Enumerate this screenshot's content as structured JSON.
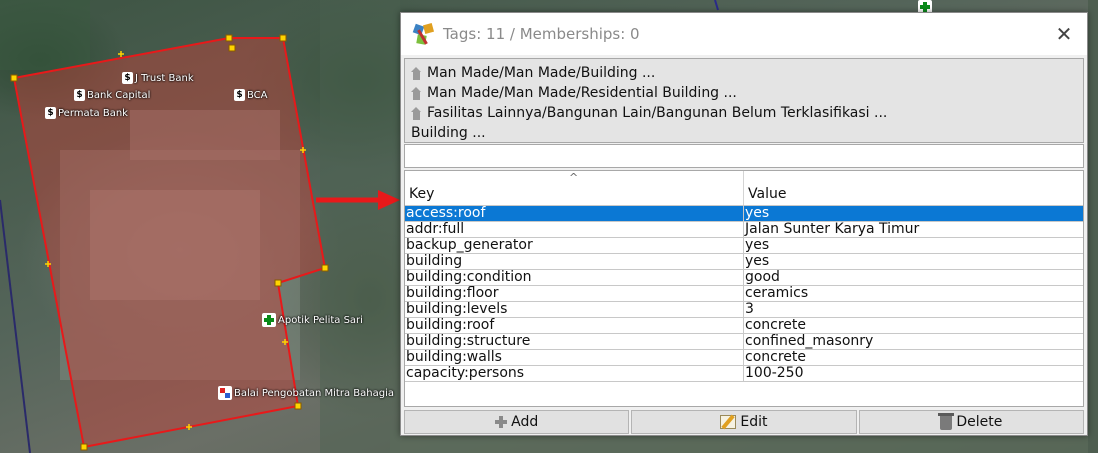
{
  "map": {
    "pois": [
      {
        "label": "J Trust Bank",
        "icon": "bank-icon"
      },
      {
        "label": "Bank Capital",
        "icon": "bank-icon"
      },
      {
        "label": "BCA",
        "icon": "bank-icon"
      },
      {
        "label": "Permata Bank",
        "icon": "bank-icon"
      },
      {
        "label": "Apotik Pelita Sari",
        "icon": "pharmacy-icon"
      },
      {
        "label": "Balai Pengobatan Mitra Bahagia",
        "icon": "clinic-icon"
      }
    ],
    "colors": {
      "building_outline": "#e8191a",
      "building_fill": "#c8403a"
    }
  },
  "dialog": {
    "title": "Tags: 11 / Memberships: 0",
    "close_label": "✕",
    "presets": [
      {
        "label": "Man Made/Man Made/Building ...",
        "icon": "house-icon"
      },
      {
        "label": "Man Made/Man Made/Residential Building ...",
        "icon": "house-icon"
      },
      {
        "label": "Fasilitas Lainnya/Bangunan Lain/Bangunan Belum Terklasifikasi ...",
        "icon": "house-icon"
      },
      {
        "label": "Building  ...",
        "icon": null
      }
    ],
    "filter": {
      "value": "",
      "placeholder": ""
    },
    "table": {
      "headers": {
        "key": "Key",
        "value": "Value",
        "sort_indicator": "^"
      },
      "rows": [
        {
          "key": "access:roof",
          "value": "yes",
          "selected": true
        },
        {
          "key": "addr:full",
          "value": "Jalan Sunter Karya Timur",
          "selected": false
        },
        {
          "key": "backup_generator",
          "value": "yes",
          "selected": false
        },
        {
          "key": "building",
          "value": "yes",
          "selected": false
        },
        {
          "key": "building:condition",
          "value": "good",
          "selected": false
        },
        {
          "key": "building:floor",
          "value": "ceramics",
          "selected": false
        },
        {
          "key": "building:levels",
          "value": "3",
          "selected": false
        },
        {
          "key": "building:roof",
          "value": "concrete",
          "selected": false
        },
        {
          "key": "building:structure",
          "value": "confined_masonry",
          "selected": false
        },
        {
          "key": "building:walls",
          "value": "concrete",
          "selected": false
        },
        {
          "key": "capacity:persons",
          "value": "100-250",
          "selected": false
        }
      ]
    },
    "buttons": {
      "add": "Add",
      "edit": "Edit",
      "delete": "Delete"
    },
    "colors": {
      "selection": "#0b78d4",
      "background": "#f0f0f0"
    }
  }
}
